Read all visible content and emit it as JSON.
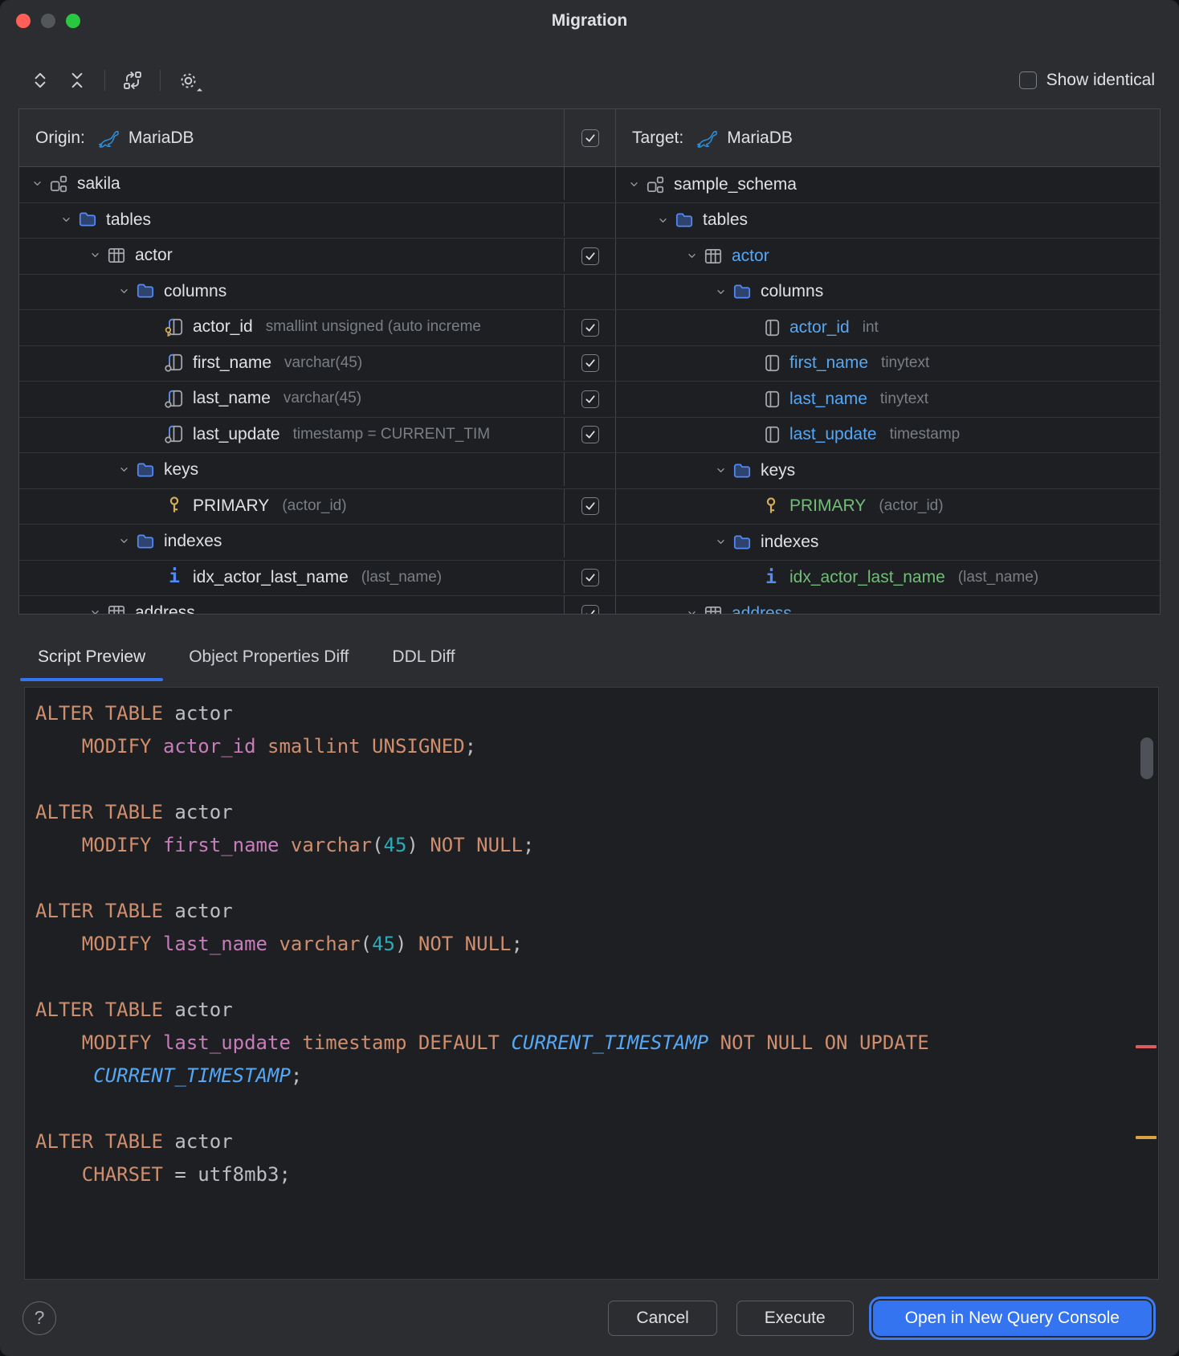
{
  "window": {
    "title": "Migration"
  },
  "toolbar": {
    "icons": [
      "expand-all-icon",
      "collapse-all-icon",
      "synchronize-icon",
      "settings-gear-icon"
    ],
    "show_identical_label": "Show identical",
    "show_identical_checked": false
  },
  "diff": {
    "origin_label": "Origin:",
    "origin_db": "MariaDB",
    "target_label": "Target:",
    "target_db": "MariaDB",
    "header_checkbox_checked": true
  },
  "colors": {
    "accent": "#3574F0",
    "modified_blue": "#56A8F5",
    "added_green": "#73BD79",
    "keyword_orange": "#CF8E6D",
    "identifier_purple": "#C77DBB",
    "number_teal": "#2AACB8",
    "error_stripe": "#DB5C5C",
    "warning_stripe": "#D9A343",
    "folder_blue": "#548AF7",
    "key_gold": "#D5AE57"
  },
  "rows": [
    {
      "left": {
        "indent": 0,
        "chevron": true,
        "icon": "schema",
        "label": "sakila"
      },
      "right": {
        "indent": 0,
        "chevron": true,
        "icon": "schema",
        "label": "sample_schema"
      },
      "checkbox": false
    },
    {
      "left": {
        "indent": 1,
        "chevron": true,
        "icon": "folder",
        "label": "tables"
      },
      "right": {
        "indent": 1,
        "chevron": true,
        "icon": "folder",
        "label": "tables"
      },
      "checkbox": false
    },
    {
      "left": {
        "indent": 2,
        "chevron": true,
        "icon": "table",
        "label": "actor"
      },
      "right": {
        "indent": 2,
        "chevron": true,
        "icon": "table",
        "label": "actor",
        "state": "modified"
      },
      "checkbox": true
    },
    {
      "left": {
        "indent": 3,
        "chevron": true,
        "icon": "folder",
        "label": "columns"
      },
      "right": {
        "indent": 3,
        "chevron": true,
        "icon": "folder",
        "label": "columns"
      },
      "checkbox": false
    },
    {
      "left": {
        "indent": 4,
        "icon": "column-key",
        "label": "actor_id",
        "detail": "smallint unsigned (auto increme"
      },
      "right": {
        "indent": 4,
        "icon": "column",
        "label": "actor_id",
        "state": "modified",
        "detail": "int"
      },
      "checkbox": true
    },
    {
      "left": {
        "indent": 4,
        "icon": "column-dot",
        "label": "first_name",
        "detail": "varchar(45)"
      },
      "right": {
        "indent": 4,
        "icon": "column",
        "label": "first_name",
        "state": "modified",
        "detail": "tinytext"
      },
      "checkbox": true
    },
    {
      "left": {
        "indent": 4,
        "icon": "column-dot",
        "label": "last_name",
        "detail": "varchar(45)"
      },
      "right": {
        "indent": 4,
        "icon": "column",
        "label": "last_name",
        "state": "modified",
        "detail": "tinytext"
      },
      "checkbox": true
    },
    {
      "left": {
        "indent": 4,
        "icon": "column-dot",
        "label": "last_update",
        "detail": "timestamp = CURRENT_TIM"
      },
      "right": {
        "indent": 4,
        "icon": "column",
        "label": "last_update",
        "state": "modified",
        "detail": "timestamp"
      },
      "checkbox": true
    },
    {
      "left": {
        "indent": 3,
        "chevron": true,
        "icon": "folder",
        "label": "keys"
      },
      "right": {
        "indent": 3,
        "chevron": true,
        "icon": "folder",
        "label": "keys"
      },
      "checkbox": false
    },
    {
      "left": {
        "indent": 4,
        "icon": "key",
        "label": "PRIMARY",
        "detail": "(actor_id)"
      },
      "right": {
        "indent": 4,
        "icon": "key",
        "label": "PRIMARY",
        "state": "added",
        "detail": "(actor_id)"
      },
      "checkbox": true
    },
    {
      "left": {
        "indent": 3,
        "chevron": true,
        "icon": "folder",
        "label": "indexes"
      },
      "right": {
        "indent": 3,
        "chevron": true,
        "icon": "folder",
        "label": "indexes"
      },
      "checkbox": false
    },
    {
      "left": {
        "indent": 4,
        "icon": "index",
        "label": "idx_actor_last_name",
        "detail": "(last_name)"
      },
      "right": {
        "indent": 4,
        "icon": "index",
        "label": "idx_actor_last_name",
        "state": "added",
        "detail": "(last_name)"
      },
      "checkbox": true
    },
    {
      "left": {
        "indent": 2,
        "chevron": true,
        "icon": "table",
        "label": "address"
      },
      "right": {
        "indent": 2,
        "chevron": true,
        "icon": "table",
        "label": "address",
        "state": "modified"
      },
      "checkbox": true
    }
  ],
  "tabs": [
    {
      "label": "Script Preview",
      "active": true
    },
    {
      "label": "Object Properties Diff",
      "active": false
    },
    {
      "label": "DDL Diff",
      "active": false
    }
  ],
  "script_lines": [
    [
      [
        "k",
        "ALTER TABLE"
      ],
      [
        "p",
        " actor"
      ]
    ],
    [
      [
        "p",
        "    "
      ],
      [
        "k",
        "MODIFY"
      ],
      [
        "p",
        " "
      ],
      [
        "v",
        "actor_id"
      ],
      [
        "p",
        " "
      ],
      [
        "k",
        "smallint UNSIGNED"
      ],
      [
        "p",
        ";"
      ]
    ],
    [],
    [
      [
        "k",
        "ALTER TABLE"
      ],
      [
        "p",
        " actor"
      ]
    ],
    [
      [
        "p",
        "    "
      ],
      [
        "k",
        "MODIFY"
      ],
      [
        "p",
        " "
      ],
      [
        "v",
        "first_name"
      ],
      [
        "p",
        " "
      ],
      [
        "k",
        "varchar"
      ],
      [
        "p",
        "("
      ],
      [
        "n",
        "45"
      ],
      [
        "p",
        ") "
      ],
      [
        "k",
        "NOT NULL"
      ],
      [
        "p",
        ";"
      ]
    ],
    [],
    [
      [
        "k",
        "ALTER TABLE"
      ],
      [
        "p",
        " actor"
      ]
    ],
    [
      [
        "p",
        "    "
      ],
      [
        "k",
        "MODIFY"
      ],
      [
        "p",
        " "
      ],
      [
        "v",
        "last_name"
      ],
      [
        "p",
        " "
      ],
      [
        "k",
        "varchar"
      ],
      [
        "p",
        "("
      ],
      [
        "n",
        "45"
      ],
      [
        "p",
        ") "
      ],
      [
        "k",
        "NOT NULL"
      ],
      [
        "p",
        ";"
      ]
    ],
    [],
    [
      [
        "k",
        "ALTER TABLE"
      ],
      [
        "p",
        " actor"
      ]
    ],
    [
      [
        "p",
        "    "
      ],
      [
        "k",
        "MODIFY"
      ],
      [
        "p",
        " "
      ],
      [
        "v",
        "last_update"
      ],
      [
        "p",
        " "
      ],
      [
        "k",
        "timestamp"
      ],
      [
        "p",
        " "
      ],
      [
        "k",
        "DEFAULT"
      ],
      [
        "p",
        " "
      ],
      [
        "b",
        "CURRENT_TIMESTAMP"
      ],
      [
        "p",
        " "
      ],
      [
        "k",
        "NOT NULL ON UPDATE"
      ]
    ],
    [
      [
        "p",
        "     "
      ],
      [
        "b",
        "CURRENT_TIMESTAMP"
      ],
      [
        "p",
        ";"
      ]
    ],
    [],
    [
      [
        "k",
        "ALTER TABLE"
      ],
      [
        "p",
        " actor"
      ]
    ],
    [
      [
        "p",
        "    "
      ],
      [
        "k",
        "CHARSET"
      ],
      [
        "p",
        " = utf8mb3;"
      ]
    ]
  ],
  "footer": {
    "help": "?",
    "cancel_label": "Cancel",
    "execute_label": "Execute",
    "open_console_label": "Open in New Query Console"
  }
}
